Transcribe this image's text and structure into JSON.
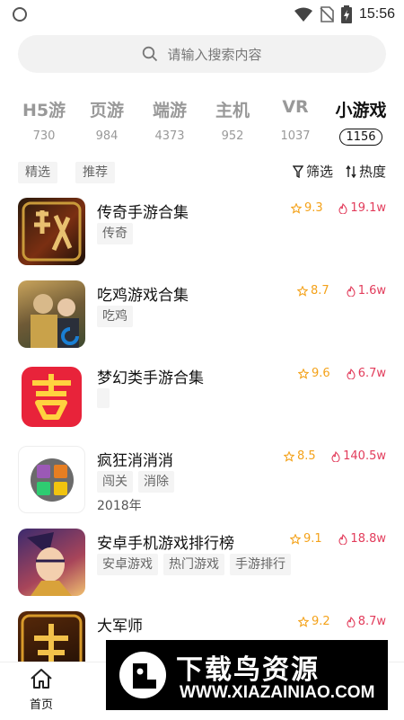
{
  "status_bar": {
    "time": "15:56"
  },
  "search": {
    "placeholder": "请输入搜索内容"
  },
  "tabs": [
    {
      "label": "H5游",
      "count": "730"
    },
    {
      "label": "页游",
      "count": "984"
    },
    {
      "label": "端游",
      "count": "4373"
    },
    {
      "label": "主机",
      "count": "952"
    },
    {
      "label": "VR",
      "count": "1037"
    },
    {
      "label": "小游戏",
      "count": "1156",
      "active": true
    }
  ],
  "filters": {
    "chips": [
      "精选",
      "推荐"
    ],
    "filter_label": "筛选",
    "sort_label": "热度"
  },
  "games": [
    {
      "title": "传奇手游合集",
      "tags": [
        "传奇"
      ],
      "rating": "9.3",
      "heat": "19.1w",
      "icon": "legend-game-icon"
    },
    {
      "title": "吃鸡游戏合集",
      "tags": [
        "吃鸡"
      ],
      "rating": "8.7",
      "heat": "1.6w",
      "icon": "battle-royale-game-icon"
    },
    {
      "title": "梦幻类手游合集",
      "tags": [],
      "rating": "9.6",
      "heat": "6.7w",
      "icon": "fantasy-game-icon"
    },
    {
      "title": "疯狂消消消",
      "tags": [
        "闯关",
        "消除"
      ],
      "year": "2018年",
      "rating": "8.5",
      "heat": "140.5w",
      "icon": "match-puzzle-game-icon"
    },
    {
      "title": "安卓手机游戏排行榜",
      "tags": [
        "安卓游戏",
        "热门游戏",
        "手游排行"
      ],
      "rating": "9.1",
      "heat": "18.8w",
      "icon": "android-ranking-game-icon"
    },
    {
      "title": "大军师",
      "tags": [],
      "rating": "9.2",
      "heat": "8.7w",
      "icon": "strategist-game-icon"
    }
  ],
  "bottom_nav": {
    "home_label": "首页"
  },
  "watermark": {
    "title": "下载鸟资源",
    "url": "WWW.XIAZAINIAO.COM"
  },
  "colors": {
    "rating": "#f4a21a",
    "heat": "#e23c5b",
    "active_tab": "#111111",
    "inactive_tab": "#999999"
  }
}
